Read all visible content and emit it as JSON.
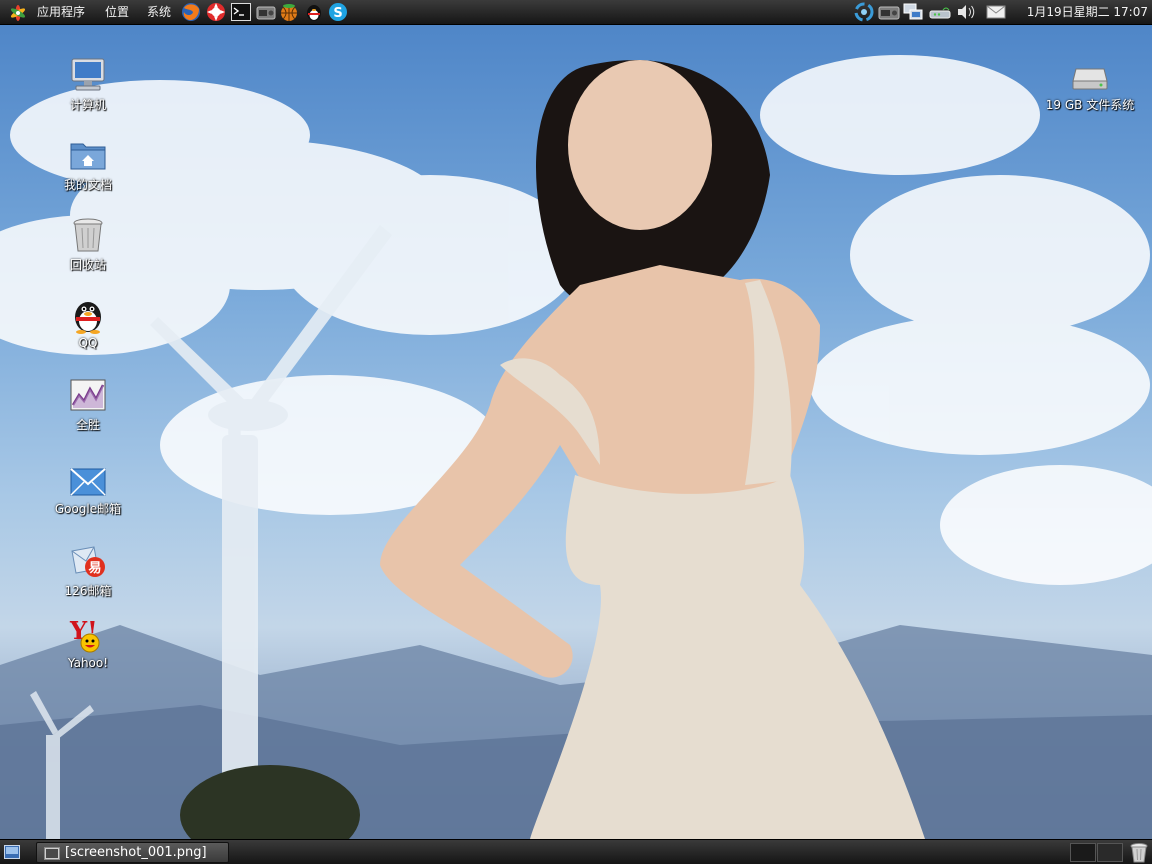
{
  "top_panel": {
    "menus": [
      {
        "label": "应用程序"
      },
      {
        "label": "位置"
      },
      {
        "label": "系统"
      }
    ],
    "launchers": [
      "firefox-icon",
      "help-icon",
      "terminal-icon",
      "radio-icon",
      "basketball-icon",
      "qq-icon",
      "skype-icon"
    ],
    "tray": [
      "network-spinner-icon",
      "radio-icon",
      "network-connection-icon",
      "modem-icon",
      "volume-icon",
      "mail-icon"
    ],
    "clock": "1月19日星期二 17:07"
  },
  "desktop": {
    "icons": [
      {
        "label": "计算机",
        "icon": "computer-icon"
      },
      {
        "label": "我的文档",
        "icon": "home-folder-icon"
      },
      {
        "label": "回收站",
        "icon": "trash-icon"
      },
      {
        "label": "QQ",
        "icon": "qq-penguin-icon"
      },
      {
        "label": "全胜",
        "icon": "stock-chart-icon"
      },
      {
        "label": "Google邮箱",
        "icon": "mail-envelope-icon"
      },
      {
        "label": "126邮箱",
        "icon": "mail-126-icon"
      },
      {
        "label": "Yahoo!",
        "icon": "yahoo-icon"
      },
      {
        "label": "19 GB 文件系统",
        "icon": "drive-icon"
      }
    ]
  },
  "bottom_panel": {
    "task": {
      "label": "[screenshot_001.png]",
      "icon": "image-viewer-icon"
    },
    "workspaces": 2,
    "trash": "trash-applet-icon"
  },
  "colors": {
    "panel": "#1e1e1e",
    "sky": "#79a9da",
    "label_text": "#ffffff"
  }
}
